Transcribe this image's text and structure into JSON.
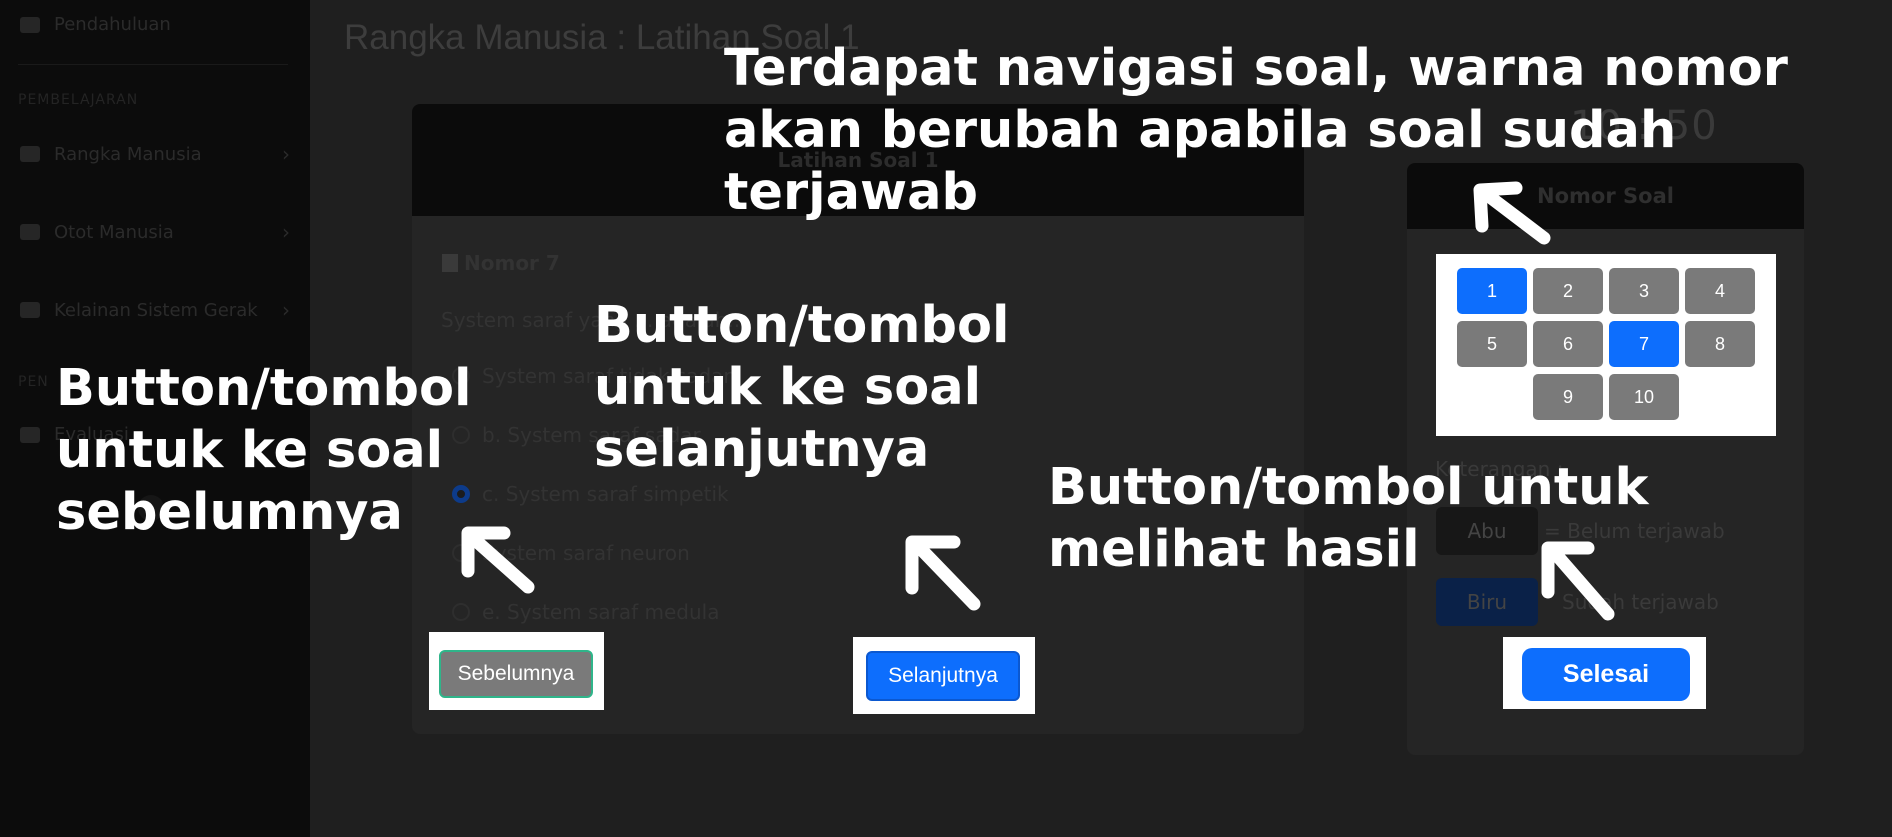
{
  "sidebar": {
    "top_item": "Pendahuluan",
    "section_learning": "PEMBELAJARAN",
    "items": [
      {
        "label": "Rangka Manusia"
      },
      {
        "label": "Otot Manusia"
      },
      {
        "label": "Kelainan Sistem Gerak"
      }
    ],
    "section_eval": "PEN",
    "eval_item": "Evaluasi"
  },
  "page": {
    "title": "Rangka Manusia : Latihan Soal 1"
  },
  "quiz": {
    "header": "Latihan Soal 1",
    "number_label": "Nomor 7",
    "question": "System saraf yang ... adalah...",
    "options": [
      {
        "label": "System saraf tidak sadar",
        "selected": false
      },
      {
        "label": "b. System saraf sadar",
        "selected": false
      },
      {
        "label": "c. System saraf simpetik",
        "selected": true
      },
      {
        "label": "System saraf neuron",
        "selected": false
      },
      {
        "label": "e. System saraf medula",
        "selected": false
      }
    ],
    "prev_button": "Sebelumnya",
    "next_button": "Selanjutnya"
  },
  "timer": "10 : 50",
  "navigator": {
    "header": "Nomor Soal",
    "numbers": [
      "1",
      "2",
      "3",
      "4",
      "5",
      "6",
      "7",
      "8",
      "9",
      "10"
    ],
    "active_numbers": [
      "1",
      "7"
    ],
    "keterangan_label": "Keterangan :",
    "legend_abu": "Abu",
    "legend_abu_text": "= Belum terjawab",
    "legend_biru": "Biru",
    "legend_biru_text": "Sudah terjawab",
    "finish_button": "Selesai"
  },
  "annotations": {
    "navigation": "Terdapat navigasi soal, warna nomor akan berubah apabila soal sudah terjawab",
    "next": "Button/tombol untuk ke soal selanjutnya",
    "prev": "Button/tombol untuk ke soal sebelumnya",
    "finish": "Button/tombol untuk melihat hasil"
  },
  "colors": {
    "primary_blue": "#0d6efd",
    "grey_button": "#7a7a7a",
    "overlay_text": "#ffffff"
  }
}
